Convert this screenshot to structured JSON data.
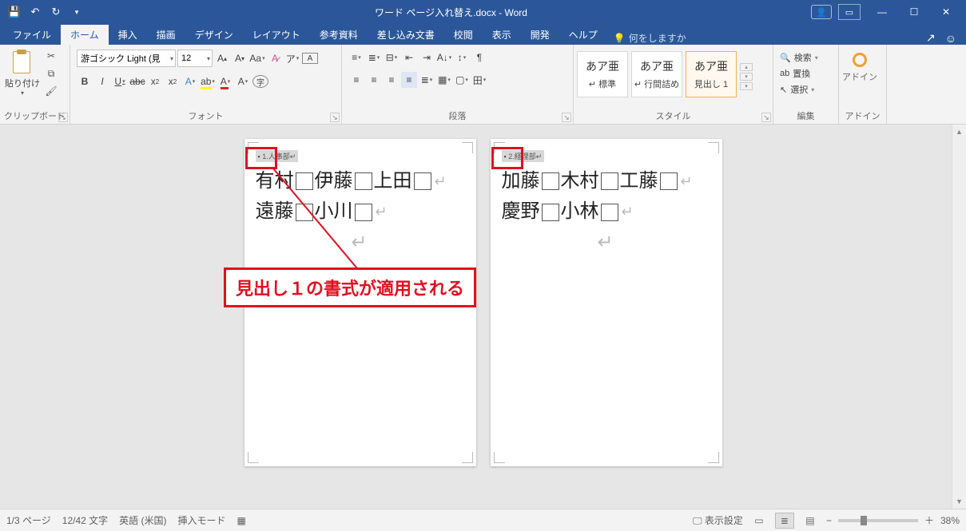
{
  "titlebar": {
    "doc_title": "ワード ページ入れ替え.docx - Word"
  },
  "tabs": {
    "file": "ファイル",
    "home": "ホーム",
    "insert": "挿入",
    "draw": "描画",
    "design": "デザイン",
    "layout": "レイアウト",
    "references": "参考資料",
    "mailings": "差し込み文書",
    "review": "校閲",
    "view": "表示",
    "developer": "開発",
    "help": "ヘルプ",
    "tellme": "何をしますか"
  },
  "ribbon": {
    "clipboard": {
      "paste": "貼り付け",
      "label": "クリップボード"
    },
    "font": {
      "name": "游ゴシック Light (見",
      "size": "12",
      "label": "フォント"
    },
    "paragraph": {
      "label": "段落"
    },
    "styles": {
      "label": "スタイル",
      "sample": "あア亜",
      "items": [
        "標準",
        "行間詰め",
        "見出し 1"
      ]
    },
    "editing": {
      "find": "検索",
      "replace": "置換",
      "select": "選択",
      "label": "編集"
    },
    "addin": {
      "label": "アドイン",
      "btn": "アドイン"
    }
  },
  "document": {
    "page1": {
      "heading": "1.人事部",
      "line1": [
        "有村",
        "伊藤",
        "上田"
      ],
      "line2": [
        "遠藤",
        "小川"
      ]
    },
    "page2": {
      "heading": "2.経理部",
      "line1": [
        "加藤",
        "木村",
        "工藤"
      ],
      "line2": [
        "慶野",
        "小林"
      ]
    }
  },
  "annotation": {
    "callout": "見出し１の書式が適用される"
  },
  "statusbar": {
    "page": "1/3 ページ",
    "words": "12/42 文字",
    "lang": "英語 (米国)",
    "mode": "挿入モード",
    "display_setting": "表示設定",
    "zoom": "38%"
  }
}
